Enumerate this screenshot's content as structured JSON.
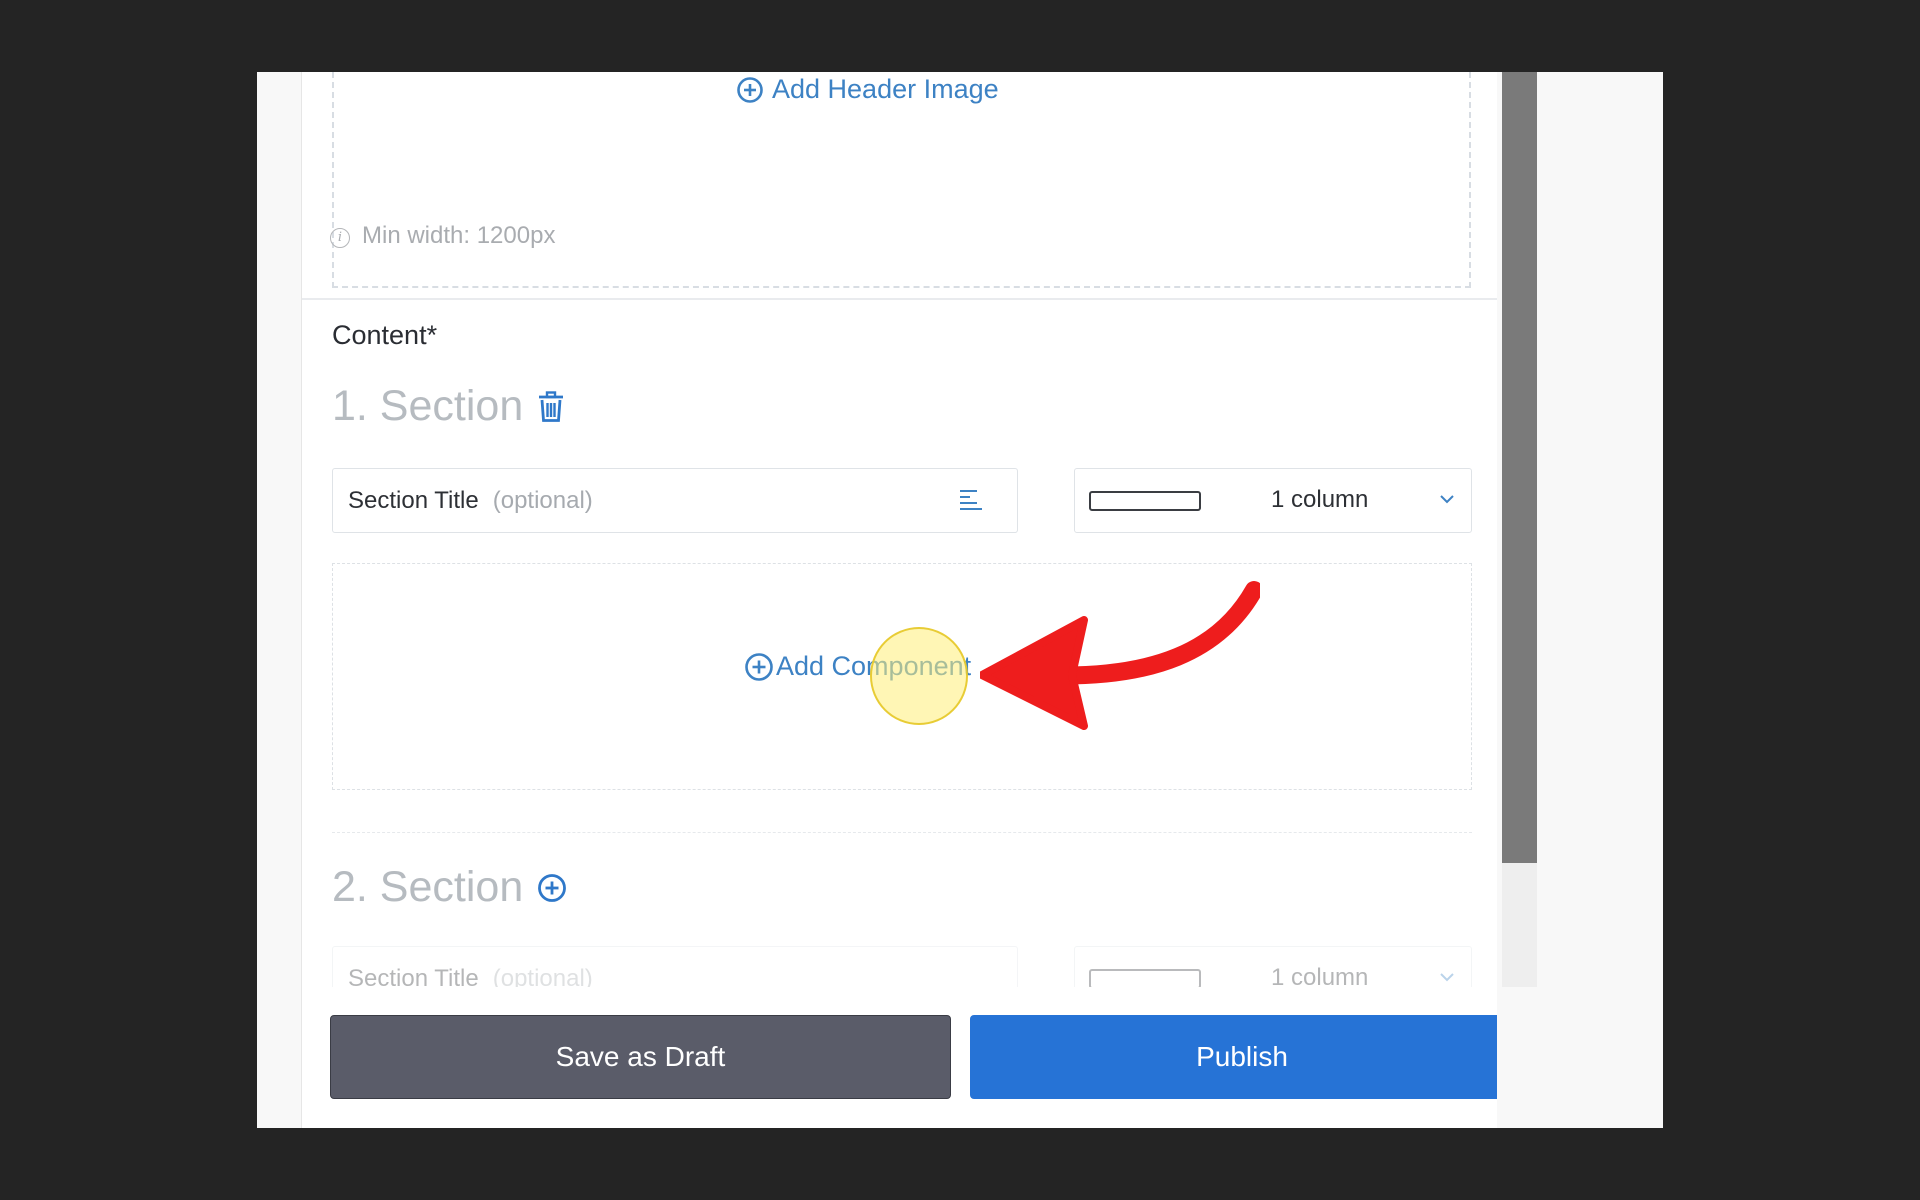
{
  "header_image": {
    "add_label": "Add Header Image",
    "hint": "Min width: 1200px"
  },
  "content": {
    "label": "Content*",
    "sections": [
      {
        "heading": "1. Section",
        "title_label": "Section Title",
        "title_placeholder": "(optional)",
        "columns_value": "1 column",
        "add_component_label": "Add Component"
      },
      {
        "heading": "2. Section",
        "title_label": "Section Title",
        "title_placeholder": "(optional)",
        "columns_value": "1 column"
      }
    ]
  },
  "actions": {
    "save_draft_label": "Save as Draft",
    "publish_label": "Publish"
  },
  "colors": {
    "accent_blue": "#3d82c4",
    "publish_blue": "#2673d6",
    "draft_gray": "#5a5c69",
    "annotation_red": "#ee1d1d",
    "click_highlight": "#ffee78"
  },
  "icons": {
    "add_header": "plus-circle-icon",
    "info": "info-icon",
    "delete_section": "trash-icon",
    "text_align": "align-left-icon",
    "dropdown": "chevron-down-icon",
    "add_section": "plus-circle-icon",
    "add_component": "plus-circle-icon"
  }
}
